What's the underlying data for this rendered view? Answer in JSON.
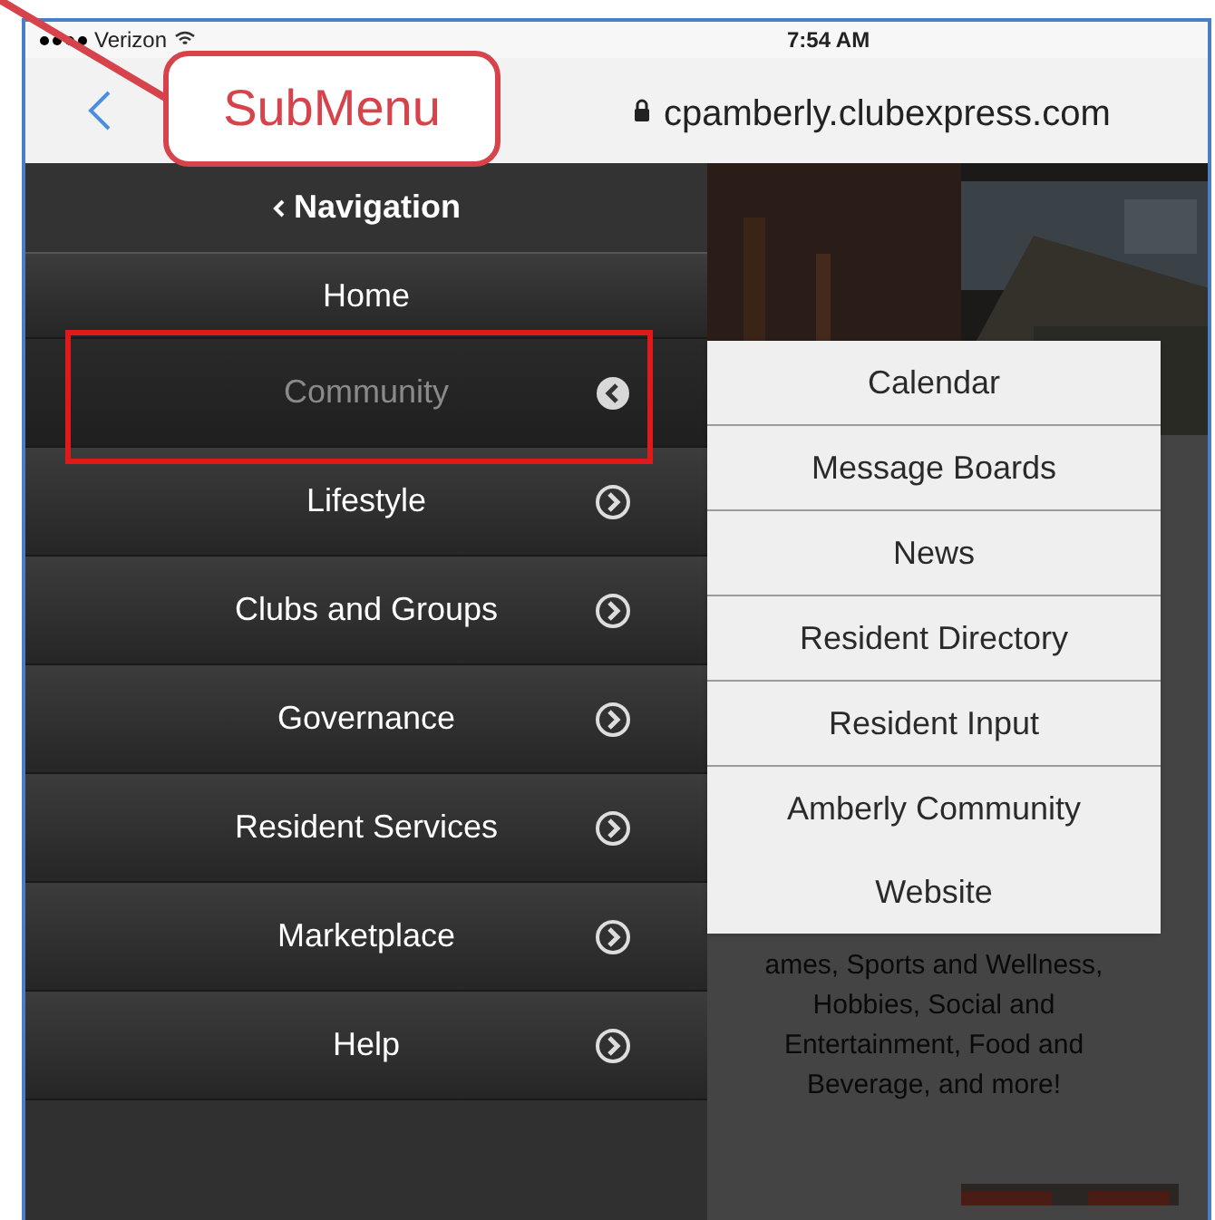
{
  "status_bar": {
    "carrier": "Verizon",
    "time": "7:54 AM"
  },
  "address_bar": {
    "url": "cpamberly.clubexpress.com"
  },
  "callout": {
    "label": "SubMenu"
  },
  "navigation": {
    "title": "Navigation",
    "items": [
      {
        "label": "Home",
        "has_submenu": false,
        "selected": false
      },
      {
        "label": "Community",
        "has_submenu": true,
        "selected": true
      },
      {
        "label": "Lifestyle",
        "has_submenu": true,
        "selected": false
      },
      {
        "label": "Clubs and Groups",
        "has_submenu": true,
        "selected": false
      },
      {
        "label": "Governance",
        "has_submenu": true,
        "selected": false
      },
      {
        "label": "Resident Services",
        "has_submenu": true,
        "selected": false
      },
      {
        "label": "Marketplace",
        "has_submenu": true,
        "selected": false
      },
      {
        "label": "Help",
        "has_submenu": true,
        "selected": false
      }
    ]
  },
  "submenu": {
    "items": [
      {
        "label": "Calendar"
      },
      {
        "label": "Message Boards"
      },
      {
        "label": "News"
      },
      {
        "label": "Resident Directory"
      },
      {
        "label": "Resident Input"
      },
      {
        "label": "Amberly Community Website"
      }
    ]
  },
  "background_text": [
    "ames, Sports and Wellness,",
    "Hobbies, Social and",
    "Entertainment, Food and",
    "Beverage, and more!"
  ]
}
